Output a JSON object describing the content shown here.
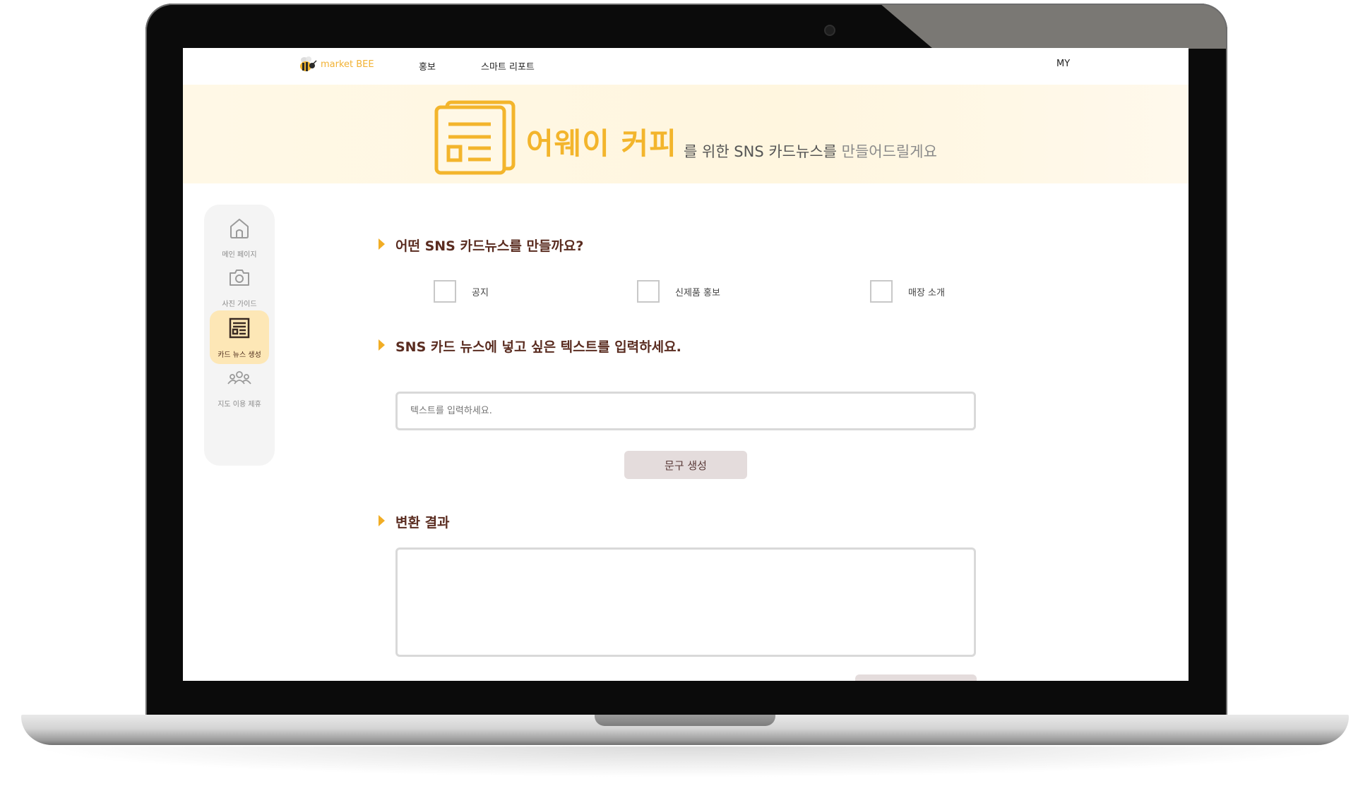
{
  "nav": {
    "logo_text": "market BEE",
    "items": [
      "홍보",
      "스마트 리포트"
    ],
    "my": "MY"
  },
  "banner": {
    "title": "어웨이 커피",
    "subtitle_main": "를 위한 SNS 카드뉴스를",
    "subtitle_light": " 만들어드릴게요"
  },
  "sidebar": {
    "items": [
      {
        "label": "메인 페이지",
        "icon": "home-icon",
        "active": false
      },
      {
        "label": "사진 가이드",
        "icon": "camera-icon",
        "active": false
      },
      {
        "label": "카드 뉴스 생성",
        "icon": "card-news-icon",
        "active": true
      },
      {
        "label": "지도 이용 제휴",
        "icon": "people-icon",
        "active": false
      }
    ]
  },
  "form": {
    "q1": "어떤 SNS 카드뉴스를 만들까요?",
    "options": [
      "공지",
      "신제품 홍보",
      "매장 소개"
    ],
    "q2": "SNS 카드 뉴스에 넣고 싶은 텍스트를 입력하세요.",
    "input_placeholder": "텍스트를 입력하세요.",
    "generate_button": "문구 생성",
    "q3": "변환 결과",
    "result_value": ""
  },
  "colors": {
    "accent": "#f3b52c",
    "heading": "#5a2c20",
    "active_bg": "#fde7b6",
    "banner_bg": "#fff8e6",
    "button_bg": "#e4dcdc"
  }
}
